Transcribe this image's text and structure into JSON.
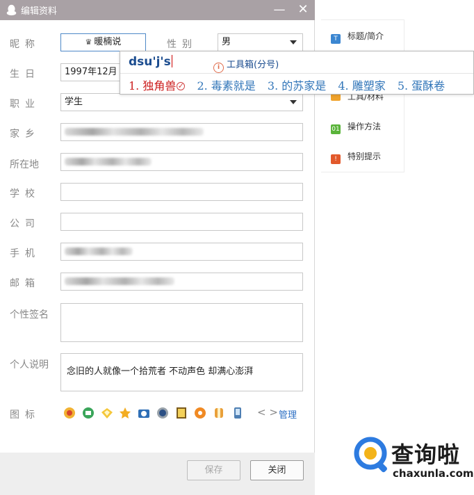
{
  "window": {
    "title": "编辑资料",
    "minimize_glyph": "—",
    "close_glyph": "✕"
  },
  "form": {
    "nickname_label": "昵称",
    "nickname_value": "暖楠说",
    "gender_label": "性别",
    "gender_value": "男",
    "birthday_label": "生日",
    "birthday_value": "1997年12月",
    "job_label": "职业",
    "job_value": "学生",
    "hometown_label": "家乡",
    "location_label": "所在地",
    "school_label": "学校",
    "company_label": "公司",
    "phone_label": "手机",
    "email_label": "邮箱",
    "signature_label": "个性签名",
    "description_label": "个人说明",
    "description_value": "念旧的人就像一个拾荒者 不动声色 却满心澎湃",
    "icons_label": "图标",
    "manage_label": "管理"
  },
  "footer": {
    "save_label": "保存",
    "close_label": "关闭"
  },
  "ime": {
    "input": "dsu'j's",
    "toolbox": "工具箱(分号)",
    "candidates": [
      "1. 独角兽",
      "2. 毒素就是",
      "3. 的苏家是",
      "4. 雕塑家",
      "5. 蛋酥卷"
    ]
  },
  "right_panel": {
    "items": [
      {
        "label": "标题/简介",
        "icon": "T",
        "color": "#3b86d1"
      },
      {
        "label": "工具/材料",
        "icon": "tool",
        "color": "#f0a32c"
      },
      {
        "label": "操作方法",
        "icon": "01",
        "color": "#5ab43a"
      },
      {
        "label": "特别提示",
        "icon": "!",
        "color": "#e2592b"
      }
    ]
  },
  "watermark": {
    "text": "查询啦",
    "url": "chaxunla.com",
    "accent": "#2d7be0"
  },
  "colors": {
    "titlebar": "#a9a1a5",
    "focus_border": "#4d88c7",
    "link": "#2c6fc4"
  }
}
